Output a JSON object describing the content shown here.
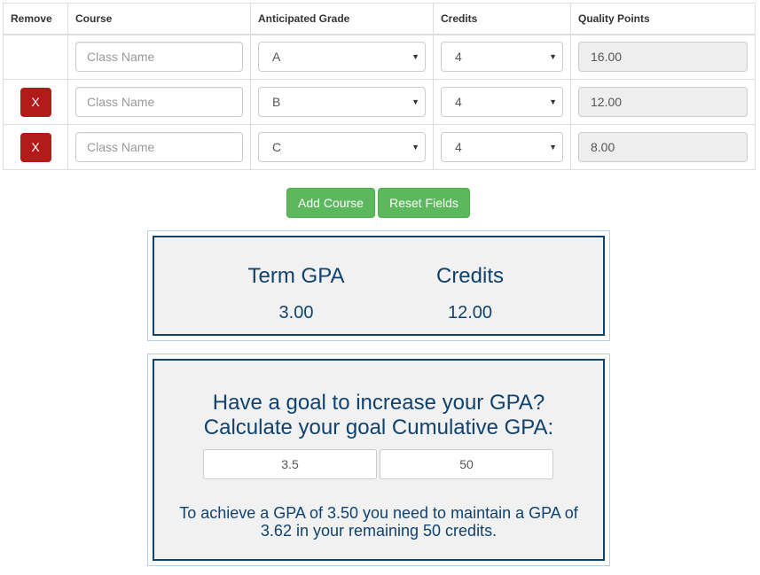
{
  "table": {
    "headers": {
      "remove": "Remove",
      "course": "Course",
      "grade": "Anticipated Grade",
      "credits": "Credits",
      "quality_points": "Quality Points"
    },
    "rows": [
      {
        "removable": false,
        "remove_label": "",
        "course_placeholder": "Class Name",
        "course_value": "",
        "grade": "A",
        "credits": "4",
        "quality_points": "16.00"
      },
      {
        "removable": true,
        "remove_label": "X",
        "course_placeholder": "Class Name",
        "course_value": "",
        "grade": "B",
        "credits": "4",
        "quality_points": "12.00"
      },
      {
        "removable": true,
        "remove_label": "X",
        "course_placeholder": "Class Name",
        "course_value": "",
        "grade": "C",
        "credits": "4",
        "quality_points": "8.00"
      }
    ]
  },
  "actions": {
    "add_course": "Add Course",
    "reset_fields": "Reset Fields"
  },
  "summary": {
    "term_gpa_label": "Term GPA",
    "term_gpa_value": "3.00",
    "credits_label": "Credits",
    "credits_value": "12.00"
  },
  "goal": {
    "heading_line1": "Have a goal to increase your GPA?",
    "heading_line2": "Calculate your goal Cumulative GPA:",
    "goal_gpa_value": "3.5",
    "remaining_credits_value": "50",
    "result_line1": "To achieve a GPA of 3.50 you need to maintain a GPA of",
    "result_line2": "3.62 in your remaining 50 credits."
  },
  "colors": {
    "remove_button": "#b31b1b",
    "green_button": "#5cb85c",
    "navy_text": "#10426e",
    "panel_bg": "#f1f1f1"
  },
  "icons": {
    "select_arrow": "caret-down-icon"
  }
}
